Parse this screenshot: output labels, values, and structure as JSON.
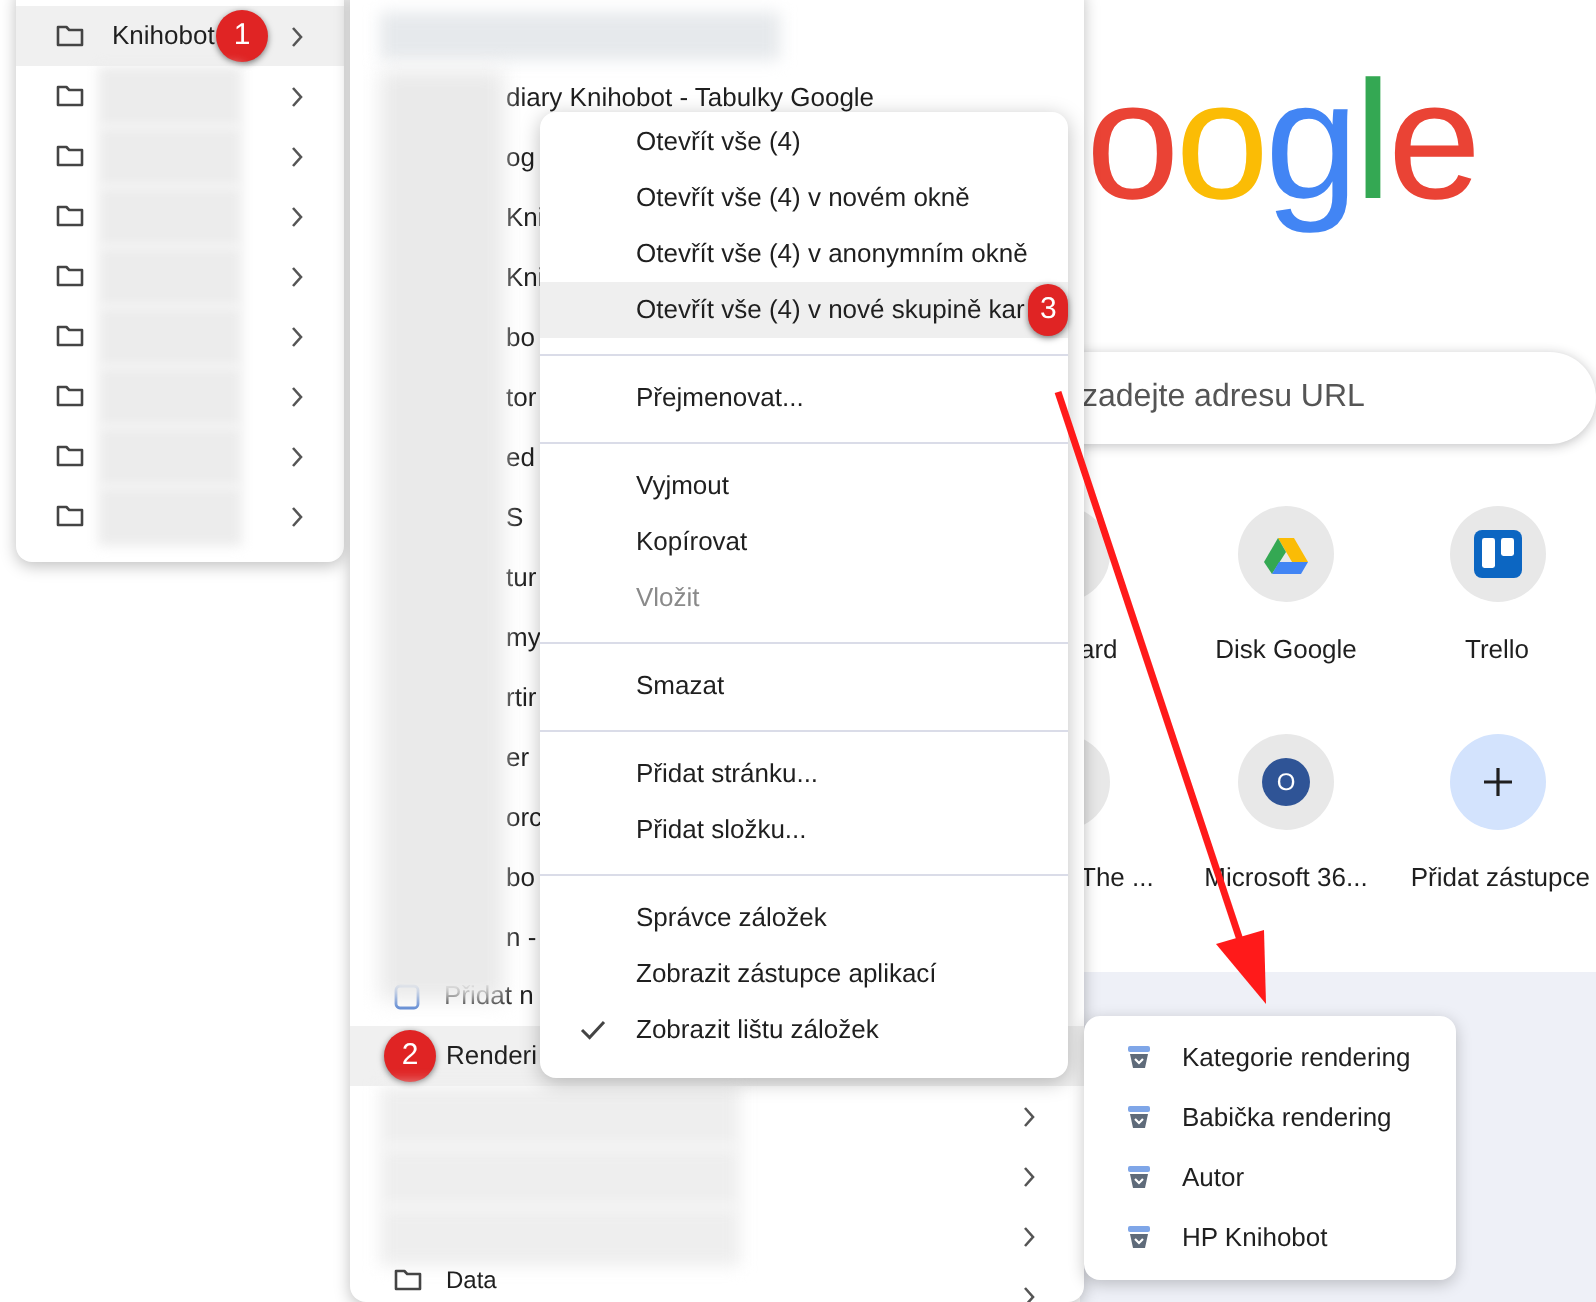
{
  "new_tab": {
    "logo": [
      {
        "char": "o",
        "color": "#ea4335"
      },
      {
        "char": "o",
        "color": "#fbbc05"
      },
      {
        "char": "g",
        "color": "#4285f4"
      },
      {
        "char": "l",
        "color": "#34a853"
      },
      {
        "char": "e",
        "color": "#ea4335"
      }
    ],
    "search": {
      "placeholder": "zadejte adresu URL"
    },
    "shortcuts": [
      {
        "kind": "partial",
        "label": "ard"
      },
      {
        "kind": "drive",
        "label": "Disk Google"
      },
      {
        "kind": "trello",
        "label": "Trello"
      },
      {
        "kind": "partial",
        "label": "The ..."
      },
      {
        "kind": "letter",
        "letter": "O",
        "label": "Microsoft 36..."
      },
      {
        "kind": "add",
        "label": "Přidat zástupce"
      }
    ]
  },
  "folder_menu": {
    "items": [
      {
        "kind": "folder",
        "label": "Knihobot",
        "selected": true,
        "badge": "1"
      },
      {
        "kind": "redacted",
        "selected": false
      },
      {
        "kind": "redacted",
        "selected": false
      },
      {
        "kind": "redacted",
        "selected": false
      },
      {
        "kind": "redacted",
        "selected": false
      },
      {
        "kind": "redacted",
        "selected": false
      },
      {
        "kind": "redacted",
        "selected": false
      },
      {
        "kind": "redacted",
        "selected": false
      },
      {
        "kind": "redacted",
        "selected": false
      }
    ]
  },
  "bookmark_menu": {
    "items": [
      {
        "kind": "redacted_top",
        "selected": false
      },
      {
        "kind": "fragment",
        "label": "diary Knihobot - Tabulky Google",
        "selected": false
      },
      {
        "kind": "fragment",
        "label": "og",
        "selected": false
      },
      {
        "kind": "fragment",
        "label": "Kni",
        "selected": false
      },
      {
        "kind": "fragment",
        "label": "Kni",
        "selected": false
      },
      {
        "kind": "fragment",
        "label": "bo",
        "selected": false
      },
      {
        "kind": "fragment",
        "label": "tor",
        "selected": false
      },
      {
        "kind": "fragment",
        "label": "ed",
        "selected": false
      },
      {
        "kind": "fragment",
        "label": "S",
        "selected": false
      },
      {
        "kind": "fragment",
        "label": "tur",
        "selected": false
      },
      {
        "kind": "fragment",
        "label": "my",
        "selected": false
      },
      {
        "kind": "fragment",
        "label": "rtir",
        "selected": false
      },
      {
        "kind": "fragment",
        "label": "er",
        "selected": false
      },
      {
        "kind": "fragment",
        "label": "orc",
        "selected": false
      },
      {
        "kind": "fragment",
        "label": "bo",
        "selected": false
      },
      {
        "kind": "fragment",
        "label": "n -",
        "selected": false
      },
      {
        "kind": "page",
        "label": "Přidat n",
        "selected": false
      },
      {
        "kind": "folder",
        "label": "Renderi",
        "selected": true,
        "badge": "2"
      },
      {
        "kind": "redacted",
        "selected": false
      },
      {
        "kind": "redacted",
        "selected": false
      },
      {
        "kind": "redacted",
        "selected": false
      },
      {
        "kind": "folder",
        "label": "Data",
        "selected": false
      }
    ]
  },
  "context_menu": {
    "groups": [
      [
        {
          "label": "Otevřít vše (4)",
          "selected": false,
          "disabled": false,
          "checked": false
        },
        {
          "label": "Otevřít vše (4) v novém okně",
          "selected": false,
          "disabled": false,
          "checked": false
        },
        {
          "label": "Otevřít vše (4) v anonymním okně",
          "selected": false,
          "disabled": false,
          "checked": false
        },
        {
          "label": "Otevřít vše (4) v nové skupině kar",
          "selected": true,
          "disabled": false,
          "checked": false,
          "badge": "3"
        }
      ],
      [
        {
          "label": "Přejmenovat...",
          "selected": false,
          "disabled": false,
          "checked": false
        }
      ],
      [
        {
          "label": "Vyjmout",
          "selected": false,
          "disabled": false,
          "checked": false
        },
        {
          "label": "Kopírovat",
          "selected": false,
          "disabled": false,
          "checked": false
        },
        {
          "label": "Vložit",
          "selected": false,
          "disabled": true,
          "checked": false
        }
      ],
      [
        {
          "label": "Smazat",
          "selected": false,
          "disabled": false,
          "checked": false
        }
      ],
      [
        {
          "label": "Přidat stránku...",
          "selected": false,
          "disabled": false,
          "checked": false
        },
        {
          "label": "Přidat složku...",
          "selected": false,
          "disabled": false,
          "checked": false
        }
      ],
      [
        {
          "label": "Správce záložek",
          "selected": false,
          "disabled": false,
          "checked": false
        },
        {
          "label": "Zobrazit zástupce aplikací",
          "selected": false,
          "disabled": false,
          "checked": false
        },
        {
          "label": "Zobrazit lištu záložek",
          "selected": false,
          "disabled": false,
          "checked": true
        }
      ]
    ]
  },
  "submenu": {
    "items": [
      {
        "label": "Kategorie rendering"
      },
      {
        "label": "Babička rendering"
      },
      {
        "label": "Autor"
      },
      {
        "label": "HP Knihobot"
      }
    ]
  }
}
